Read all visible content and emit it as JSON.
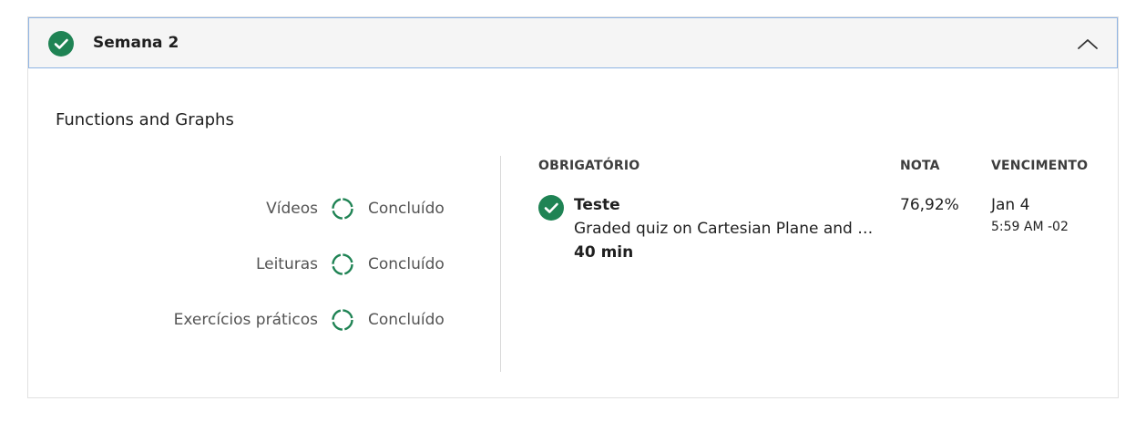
{
  "week": {
    "title": "Semana 2",
    "completed_icon": "check-circle-icon",
    "toggle_icon": "chevron-up-icon"
  },
  "module": {
    "title": "Functions and Graphs"
  },
  "progress": [
    {
      "label": "Vídeos",
      "status": "Concluído"
    },
    {
      "label": "Leituras",
      "status": "Concluído"
    },
    {
      "label": "Exercícios práticos",
      "status": "Concluído"
    }
  ],
  "columns": {
    "required": "OBRIGATÓRIO",
    "grade": "NOTA",
    "due": "VENCIMENTO"
  },
  "items": [
    {
      "type": "Teste",
      "description": "Graded quiz on Cartesian Plane and T...",
      "duration": "40 min",
      "grade": "76,92%",
      "due_date": "Jan 4",
      "due_time": "5:59 AM -02"
    }
  ],
  "colors": {
    "accent_green": "#1f8354",
    "header_bg": "#f5f5f5",
    "header_border": "#8fb4e3"
  }
}
